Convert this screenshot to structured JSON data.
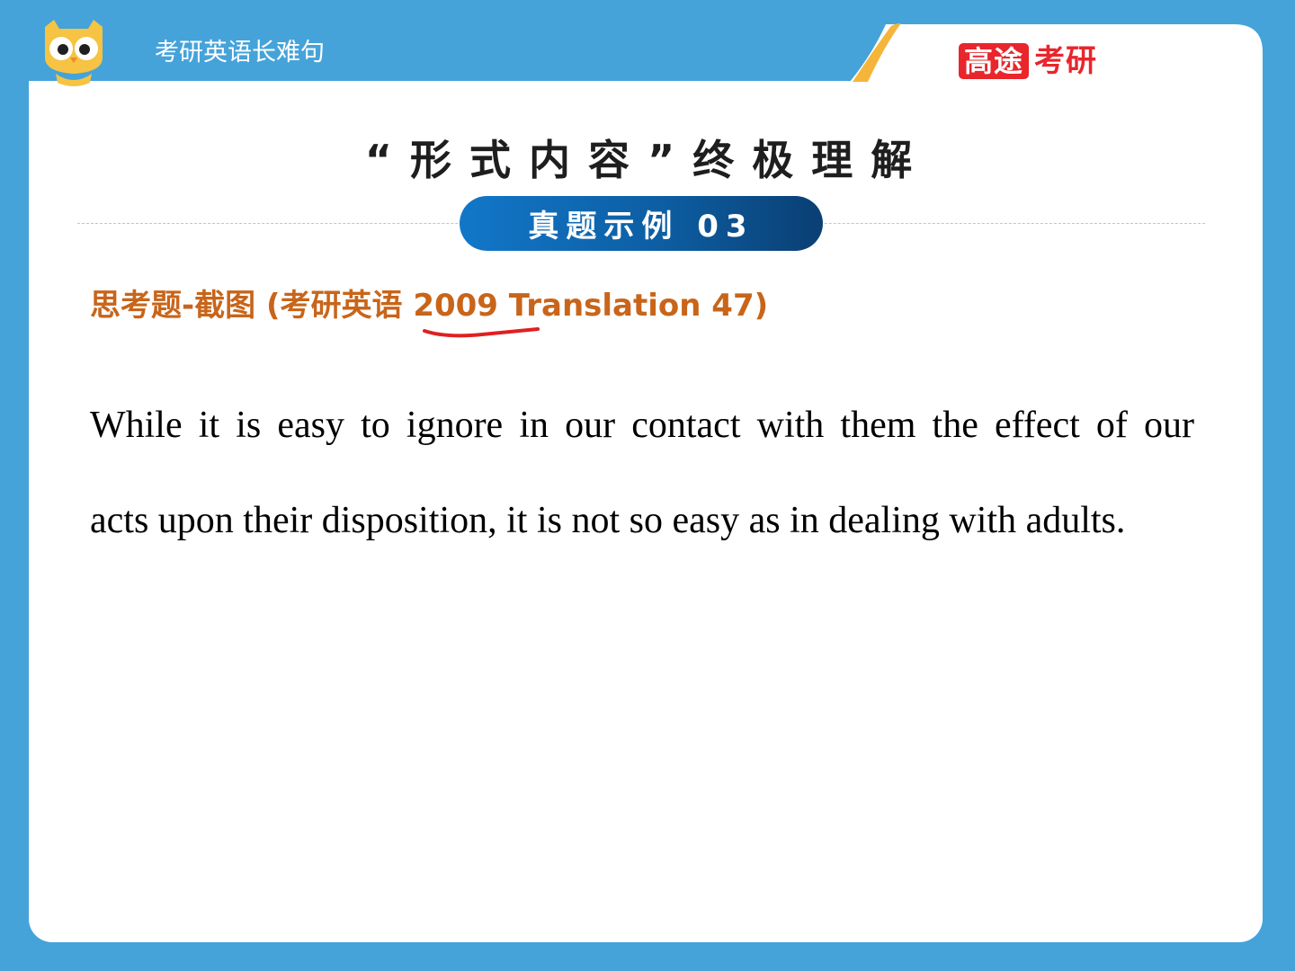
{
  "header": {
    "series_title": "考研英语长难句",
    "brand_box": "高途",
    "brand_text": "考研"
  },
  "slide": {
    "title": "“形式内容”终极理解",
    "pill_label": "真题示例 03",
    "subtitle": "思考题-截图 (考研英语 2009 Translation 47)",
    "body_line_1": "While it is easy to ignore in our contact with them the effect of our",
    "body_line_2": "acts upon their disposition, it is not so easy as in dealing with adults."
  },
  "colors": {
    "background": "#45a3da",
    "brand_red": "#e8262c",
    "subtitle_orange": "#c8651a",
    "pill_blue": "#0d5ea3",
    "underline_red": "#e02020"
  },
  "icons": {
    "mascot": "owl-mascot-icon",
    "brand": "gaotu-logo"
  }
}
